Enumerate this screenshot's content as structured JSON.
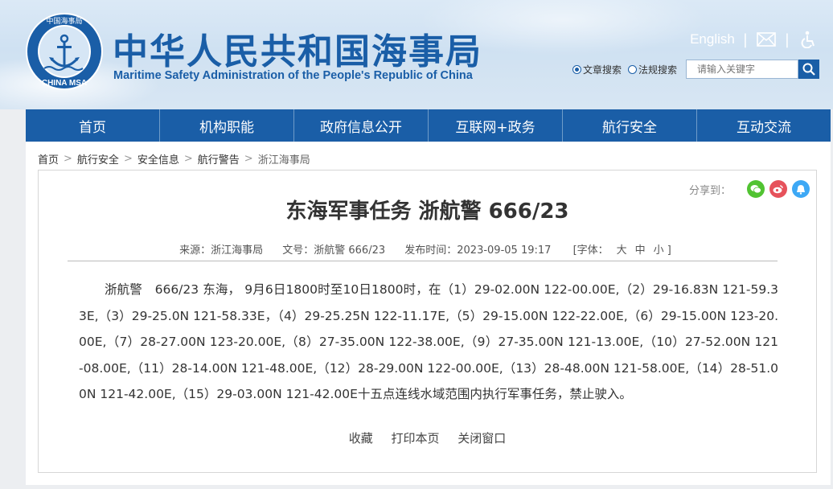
{
  "header": {
    "logo_text_top": "中国海事局",
    "logo_text_bottom": "CHINA MSA",
    "title_cn": "中华人民共和国海事局",
    "title_en": "Maritime Safety Administration of the People's Republic of China",
    "english_link": "English",
    "search": {
      "option_article": "文章搜索",
      "option_regulation": "法规搜索",
      "placeholder": "请输入关键字"
    }
  },
  "nav": {
    "items": [
      "首页",
      "机构职能",
      "政府信息公开",
      "互联网+政务",
      "航行安全",
      "互动交流"
    ]
  },
  "breadcrumb": {
    "items": [
      "首页",
      "航行安全",
      "安全信息",
      "航行警告",
      "浙江海事局"
    ]
  },
  "article": {
    "share_label": "分享到：",
    "title": "东海军事任务 浙航警 666/23",
    "meta": {
      "source": "来源：浙江海事局",
      "doc_no": "文号：浙航警 666/23",
      "publish_time": "发布时间：2023-09-05 19:17",
      "font_label": "[字体：",
      "font_large": "大",
      "font_medium": "中",
      "font_small": "小 ]"
    },
    "body": "浙航警　666/23 东海， 9月6日1800时至10日1800时，在（1）29-02.00N 122-00.00E,（2）29-16.83N 121-59.33E,（3）29-25.0N 121-58.33E，（4）29-25.25N 122-11.17E,（5）29-15.00N 122-22.00E,（6）29-15.00N 123-20.00E,（7）28-27.00N 123-20.00E,（8）27-35.00N 122-38.00E,（9）27-35.00N 121-13.00E,（10）27-52.00N 121-08.00E,（11）28-14.00N 121-48.00E,（12）28-29.00N 122-00.00E,（13）28-48.00N 121-58.00E,（14）28-51.00N 121-42.00E,（15）29-03.00N 121-42.00E十五点连线水域范围内执行军事任务，禁止驶入。",
    "actions": {
      "favorite": "收藏",
      "print": "打印本页",
      "close": "关闭窗口"
    }
  },
  "colors": {
    "brand_blue": "#1a5ea7",
    "wechat_green": "#51c332",
    "weibo_red": "#e6525b",
    "qzone_blue": "#3da8f5"
  }
}
